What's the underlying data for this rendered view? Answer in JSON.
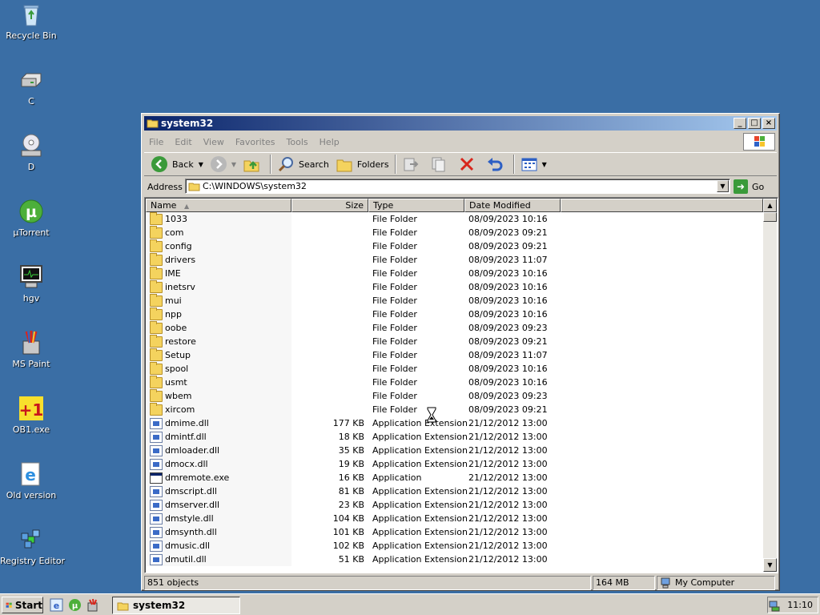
{
  "desktop": {
    "icons": [
      {
        "label": "Recycle Bin",
        "icon": "recycle-bin-icon"
      },
      {
        "label": "C",
        "icon": "drive-icon"
      },
      {
        "label": "D",
        "icon": "cd-drive-icon"
      },
      {
        "label": "µTorrent",
        "icon": "utorrent-icon"
      },
      {
        "label": "hgv",
        "icon": "monitor-icon"
      },
      {
        "label": "MS Paint",
        "icon": "paint-icon"
      },
      {
        "label": "OB1.exe",
        "icon": "ob1-icon"
      },
      {
        "label": "Old version",
        "icon": "ie-icon"
      },
      {
        "label": "Registry Editor",
        "icon": "registry-icon"
      }
    ],
    "background": "#3a6ea5"
  },
  "window": {
    "title": "system32",
    "menu": [
      "File",
      "Edit",
      "View",
      "Favorites",
      "Tools",
      "Help"
    ],
    "toolbar": {
      "back": "Back",
      "search": "Search",
      "folders": "Folders"
    },
    "address": {
      "label": "Address",
      "value": "C:\\WINDOWS\\system32",
      "go": "Go"
    },
    "columns": {
      "name": "Name",
      "size": "Size",
      "type": "Type",
      "date": "Date Modified"
    },
    "rows": [
      {
        "name": "1033",
        "size": "",
        "type": "File Folder",
        "date": "08/09/2023 10:16",
        "kind": "folder"
      },
      {
        "name": "com",
        "size": "",
        "type": "File Folder",
        "date": "08/09/2023 09:21",
        "kind": "folder"
      },
      {
        "name": "config",
        "size": "",
        "type": "File Folder",
        "date": "08/09/2023 09:21",
        "kind": "folder"
      },
      {
        "name": "drivers",
        "size": "",
        "type": "File Folder",
        "date": "08/09/2023 11:07",
        "kind": "folder"
      },
      {
        "name": "IME",
        "size": "",
        "type": "File Folder",
        "date": "08/09/2023 10:16",
        "kind": "folder"
      },
      {
        "name": "inetsrv",
        "size": "",
        "type": "File Folder",
        "date": "08/09/2023 10:16",
        "kind": "folder"
      },
      {
        "name": "mui",
        "size": "",
        "type": "File Folder",
        "date": "08/09/2023 10:16",
        "kind": "folder"
      },
      {
        "name": "npp",
        "size": "",
        "type": "File Folder",
        "date": "08/09/2023 10:16",
        "kind": "folder"
      },
      {
        "name": "oobe",
        "size": "",
        "type": "File Folder",
        "date": "08/09/2023 09:23",
        "kind": "folder"
      },
      {
        "name": "restore",
        "size": "",
        "type": "File Folder",
        "date": "08/09/2023 09:21",
        "kind": "folder"
      },
      {
        "name": "Setup",
        "size": "",
        "type": "File Folder",
        "date": "08/09/2023 11:07",
        "kind": "folder"
      },
      {
        "name": "spool",
        "size": "",
        "type": "File Folder",
        "date": "08/09/2023 10:16",
        "kind": "folder"
      },
      {
        "name": "usmt",
        "size": "",
        "type": "File Folder",
        "date": "08/09/2023 10:16",
        "kind": "folder"
      },
      {
        "name": "wbem",
        "size": "",
        "type": "File Folder",
        "date": "08/09/2023 09:23",
        "kind": "folder"
      },
      {
        "name": "xircom",
        "size": "",
        "type": "File Folder",
        "date": "08/09/2023 09:21",
        "kind": "folder"
      },
      {
        "name": "dmime.dll",
        "size": "177 KB",
        "type": "Application Extension",
        "date": "21/12/2012 13:00",
        "kind": "dll"
      },
      {
        "name": "dmintf.dll",
        "size": "18 KB",
        "type": "Application Extension",
        "date": "21/12/2012 13:00",
        "kind": "dll"
      },
      {
        "name": "dmloader.dll",
        "size": "35 KB",
        "type": "Application Extension",
        "date": "21/12/2012 13:00",
        "kind": "dll"
      },
      {
        "name": "dmocx.dll",
        "size": "19 KB",
        "type": "Application Extension",
        "date": "21/12/2012 13:00",
        "kind": "dll"
      },
      {
        "name": "dmremote.exe",
        "size": "16 KB",
        "type": "Application",
        "date": "21/12/2012 13:00",
        "kind": "exe"
      },
      {
        "name": "dmscript.dll",
        "size": "81 KB",
        "type": "Application Extension",
        "date": "21/12/2012 13:00",
        "kind": "dll"
      },
      {
        "name": "dmserver.dll",
        "size": "23 KB",
        "type": "Application Extension",
        "date": "21/12/2012 13:00",
        "kind": "dll"
      },
      {
        "name": "dmstyle.dll",
        "size": "104 KB",
        "type": "Application Extension",
        "date": "21/12/2012 13:00",
        "kind": "dll"
      },
      {
        "name": "dmsynth.dll",
        "size": "101 KB",
        "type": "Application Extension",
        "date": "21/12/2012 13:00",
        "kind": "dll"
      },
      {
        "name": "dmusic.dll",
        "size": "102 KB",
        "type": "Application Extension",
        "date": "21/12/2012 13:00",
        "kind": "dll"
      },
      {
        "name": "dmutil.dll",
        "size": "51 KB",
        "type": "Application Extension",
        "date": "21/12/2012 13:00",
        "kind": "dll"
      }
    ],
    "status": {
      "objects": "851 objects",
      "size": "164 MB",
      "zone": "My Computer"
    }
  },
  "taskbar": {
    "start": "Start",
    "task": "system32",
    "clock": "11:10"
  }
}
